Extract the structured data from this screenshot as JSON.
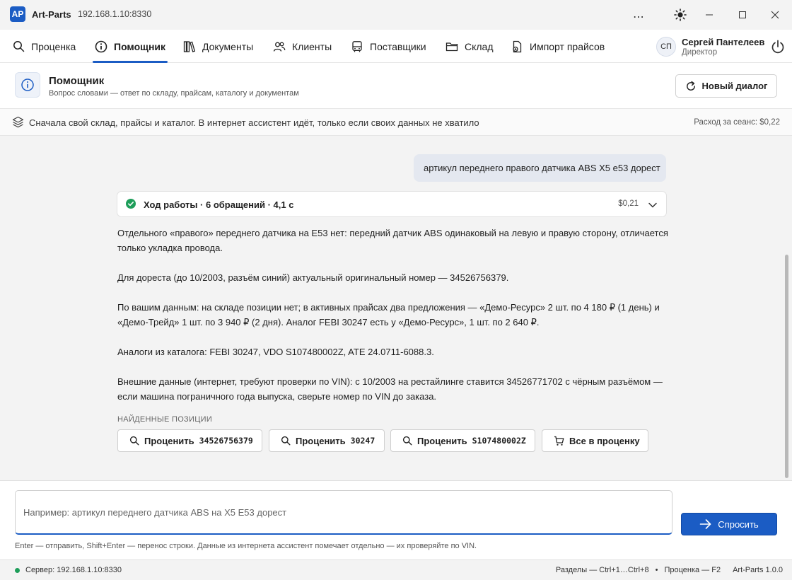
{
  "titlebar": {
    "logo": "AP",
    "app_name": "Art-Parts",
    "address": "192.168.1.10:8330"
  },
  "nav": {
    "items": [
      {
        "label": "Проценка",
        "icon": "search-icon"
      },
      {
        "label": "Помощник",
        "icon": "info-icon",
        "active": true
      },
      {
        "label": "Документы",
        "icon": "books-icon"
      },
      {
        "label": "Клиенты",
        "icon": "users-icon"
      },
      {
        "label": "Поставщики",
        "icon": "bus-icon"
      },
      {
        "label": "Склад",
        "icon": "folder-icon"
      },
      {
        "label": "Импорт прайсов",
        "icon": "file-import-icon"
      }
    ],
    "more": "⋯",
    "user": {
      "initials": "СП",
      "name": "Сергей Пантелеев",
      "role": "Директор"
    }
  },
  "header": {
    "title": "Помощник",
    "subtitle": "Вопрос словами — ответ по складу, прайсам, каталогу и документам",
    "new_dialog_label": "Новый диалог"
  },
  "infobar": {
    "text": "Сначала свой склад, прайсы и каталог. В интернет ассистент идёт, только если своих данных не хватило",
    "session_cost": "Расход за сеанс: $0,22"
  },
  "chat": {
    "user_message": "артикул переднего правого датчика ABS X5 e53 дорест",
    "progress": {
      "label": "Ход работы · 6 обращений · 4,1 с",
      "cost": "$0,21"
    },
    "answer_paragraphs": [
      "Отдельного «правого» переднего датчика на E53 нет: передний датчик ABS одинаковый на левую и правую сторону, отличается только укладка провода.",
      "Для дореста (до 10/2003, разъём синий) актуальный оригинальный номер — 34526756379.",
      "По вашим данным: на складе позиции нет; в активных прайсах два предложения — «Демо-Ресурс» 2 шт. по 4 180 ₽ (1 день) и «Демо-Трейд» 1 шт. по 3 940 ₽ (2 дня). Аналог FEBI 30247 есть у «Демо-Ресурс», 1 шт. по 2 640 ₽.",
      "Аналоги из каталога: FEBI 30247, VDO S107480002Z, ATE 24.0711-6088.3.",
      "Внешние данные (интернет, требуют проверки по VIN): с 10/2003 на рестайлинге ставится 34526771702 с чёрным разъёмом — если машина пограничного года выпуска, сверьте номер по VIN до заказа."
    ],
    "found_label": "НАЙДЕННЫЕ ПОЗИЦИИ",
    "buttons": [
      {
        "label": "Проценить",
        "code": "34526756379"
      },
      {
        "label": "Проценить",
        "code": "30247"
      },
      {
        "label": "Проценить",
        "code": "S107480002Z"
      },
      {
        "label": "Все в проценку",
        "code": ""
      }
    ]
  },
  "input": {
    "value": "",
    "placeholder": "Например: артикул переднего датчика ABS на X5 E53 дорест",
    "ask_label": "Спросить",
    "hint": "Enter — отправить, Shift+Enter — перенос строки. Данные из интернета ассистент помечает отдельно — их проверяйте по VIN."
  },
  "statusbar": {
    "server": "Сервер: 192.168.1.10:8330",
    "sections": "Разделы — Ctrl+1…Ctrl+8",
    "separator": "•",
    "pricing_hotkey": "Проценка — F2",
    "version": "Art-Parts 1.0.0"
  },
  "colors": {
    "accent": "#1b5cc4",
    "success": "#1e9e5a",
    "chat_bg": "#f3f3f3",
    "user_bubble": "#e4e8f0"
  }
}
